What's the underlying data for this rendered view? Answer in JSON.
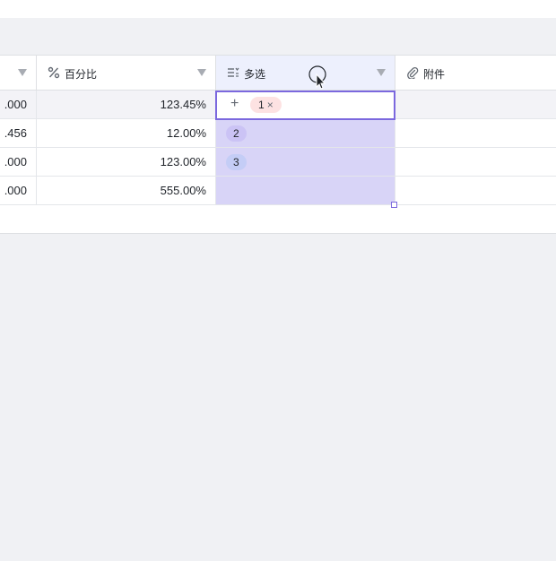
{
  "columns": [
    {
      "id": "prev",
      "label": ""
    },
    {
      "id": "percent",
      "label": "百分比",
      "icon": "percent-field-icon"
    },
    {
      "id": "multiselect",
      "label": "多选",
      "icon": "multiselect-field-icon"
    },
    {
      "id": "attachment",
      "label": "附件",
      "icon": "paperclip-icon"
    }
  ],
  "rows": [
    {
      "prev": ".000",
      "percent": "123.45%",
      "tags": [
        "1"
      ]
    },
    {
      "prev": ".456",
      "percent": "12.00%",
      "tags": [
        "2"
      ]
    },
    {
      "prev": ".000",
      "percent": "123.00%",
      "tags": [
        "3"
      ]
    },
    {
      "prev": ".000",
      "percent": "555.00%",
      "tags": []
    }
  ],
  "tag_colors": {
    "1": "#fde2e2",
    "2": "#cbc3f5",
    "3": "#c4cdf6"
  },
  "colors": {
    "accent": "#7b68de",
    "selection": "#d8d4f7",
    "header_active": "#edf0fd"
  },
  "editing": {
    "add_icon": "+",
    "remove_icon": "×"
  }
}
